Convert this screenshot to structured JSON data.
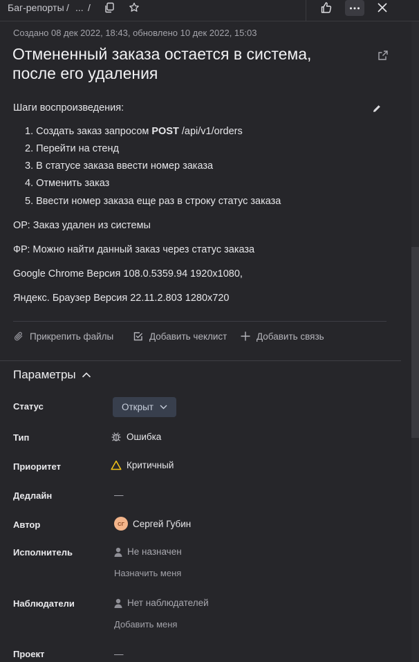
{
  "breadcrumb": {
    "root": "Баг-репорты",
    "sep1": "/",
    "ellipsis": "...",
    "sep2": "/"
  },
  "meta": "Создано 08 дек 2022, 18:43, обновлено 10 дек 2022, 15:03",
  "title": "Отмененный заказа остается в система, после его удаления",
  "description": {
    "heading": "Шаги воспроизведения:",
    "steps": [
      {
        "num": "1.",
        "pre": "Создать заказ запросом ",
        "bold": "POST",
        "post": " /api/v1/orders"
      },
      {
        "num": "2.",
        "text": "Перейти на стенд"
      },
      {
        "num": "3.",
        "text": "В статусе заказа ввести номер заказа"
      },
      {
        "num": "4.",
        "text": "Отменить заказ"
      },
      {
        "num": "5.",
        "text": "Ввести номер заказа еще раз в строку статус заказа"
      }
    ],
    "expected": "ОР: Заказ удален из системы",
    "actual": "ФР: Можно найти данный заказ через статус заказа",
    "env1": "Google Chrome Версия 108.0.5359.94 1920x1080,",
    "env2": "Яндекс. Браузер Версия 22.11.2.803 1280x720"
  },
  "actions": {
    "attach": "Прикрепить файлы",
    "checklist": "Добавить чеклист",
    "link": "Добавить связь"
  },
  "params": {
    "heading": "Параметры",
    "status_label": "Статус",
    "status_value": "Открыт",
    "type_label": "Тип",
    "type_value": "Ошибка",
    "priority_label": "Приоритет",
    "priority_value": "Критичный",
    "deadline_label": "Дедлайн",
    "deadline_value": "—",
    "author_label": "Автор",
    "author_initials": "СГ",
    "author_value": "Сергей Губин",
    "assignee_label": "Исполнитель",
    "assignee_value": "Не назначен",
    "assign_me": "Назначить меня",
    "watchers_label": "Наблюдатели",
    "watchers_value": "Нет наблюдателей",
    "add_me": "Добавить меня",
    "project_label": "Проект",
    "project_value": "—"
  },
  "colors": {
    "background": "#26262a",
    "priority_icon": "#f5c518",
    "status_pill": "#383f4d",
    "avatar": "#f2b48a"
  }
}
